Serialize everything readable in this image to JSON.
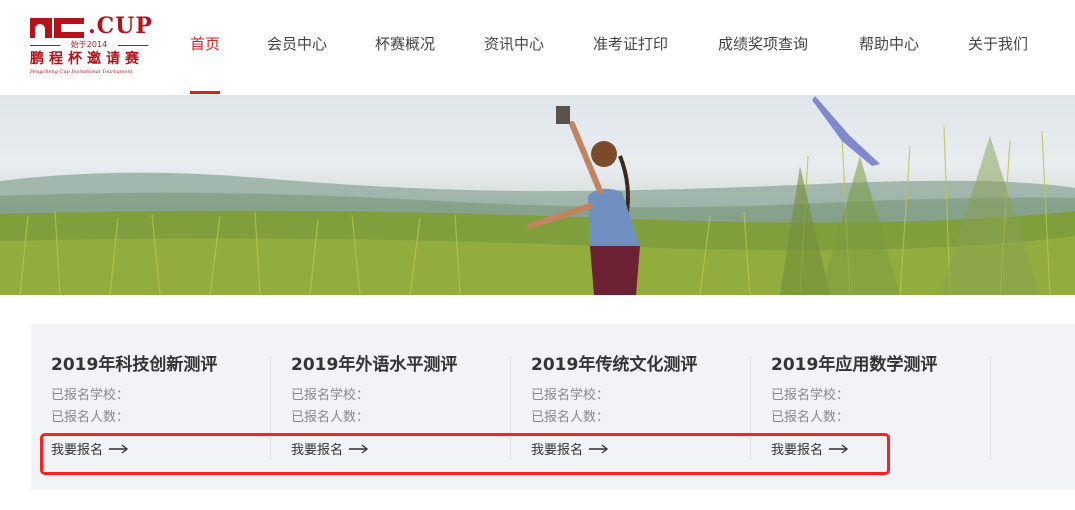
{
  "logo": {
    "cup": ".CUP",
    "since": "始于2014",
    "name_cn": "鹏程杯邀请赛",
    "name_en": "Pengcheng Cup Invitational Tournament"
  },
  "nav": {
    "items": [
      {
        "label": "首页",
        "active": true
      },
      {
        "label": "会员中心",
        "active": false
      },
      {
        "label": "杯赛概况",
        "active": false
      },
      {
        "label": "资讯中心",
        "active": false
      },
      {
        "label": "准考证打印",
        "active": false
      },
      {
        "label": "成绩奖项查询",
        "active": false
      },
      {
        "label": "帮助中心",
        "active": false
      },
      {
        "label": "关于我们",
        "active": false
      }
    ]
  },
  "banner": {
    "slide_count": 3,
    "active_slide": 3
  },
  "cards": [
    {
      "title": "2019年科技创新测评",
      "schools_label": "已报名学校：",
      "people_label": "已报名人数：",
      "signup_label": "我要报名"
    },
    {
      "title": "2019年外语水平测评",
      "schools_label": "已报名学校：",
      "people_label": "已报名人数：",
      "signup_label": "我要报名"
    },
    {
      "title": "2019年传统文化测评",
      "schools_label": "已报名学校：",
      "people_label": "已报名人数：",
      "signup_label": "我要报名"
    },
    {
      "title": "2019年应用数学测评",
      "schools_label": "已报名学校：",
      "people_label": "已报名人数：",
      "signup_label": "我要报名"
    }
  ],
  "colors": {
    "brand_red": "#b5121b",
    "accent_red": "#d9221c",
    "highlight_box": "#ff1f1f",
    "card_bg": "#f1f3f6"
  },
  "icons": {
    "signup_arrow": "right-arrow-icon"
  }
}
